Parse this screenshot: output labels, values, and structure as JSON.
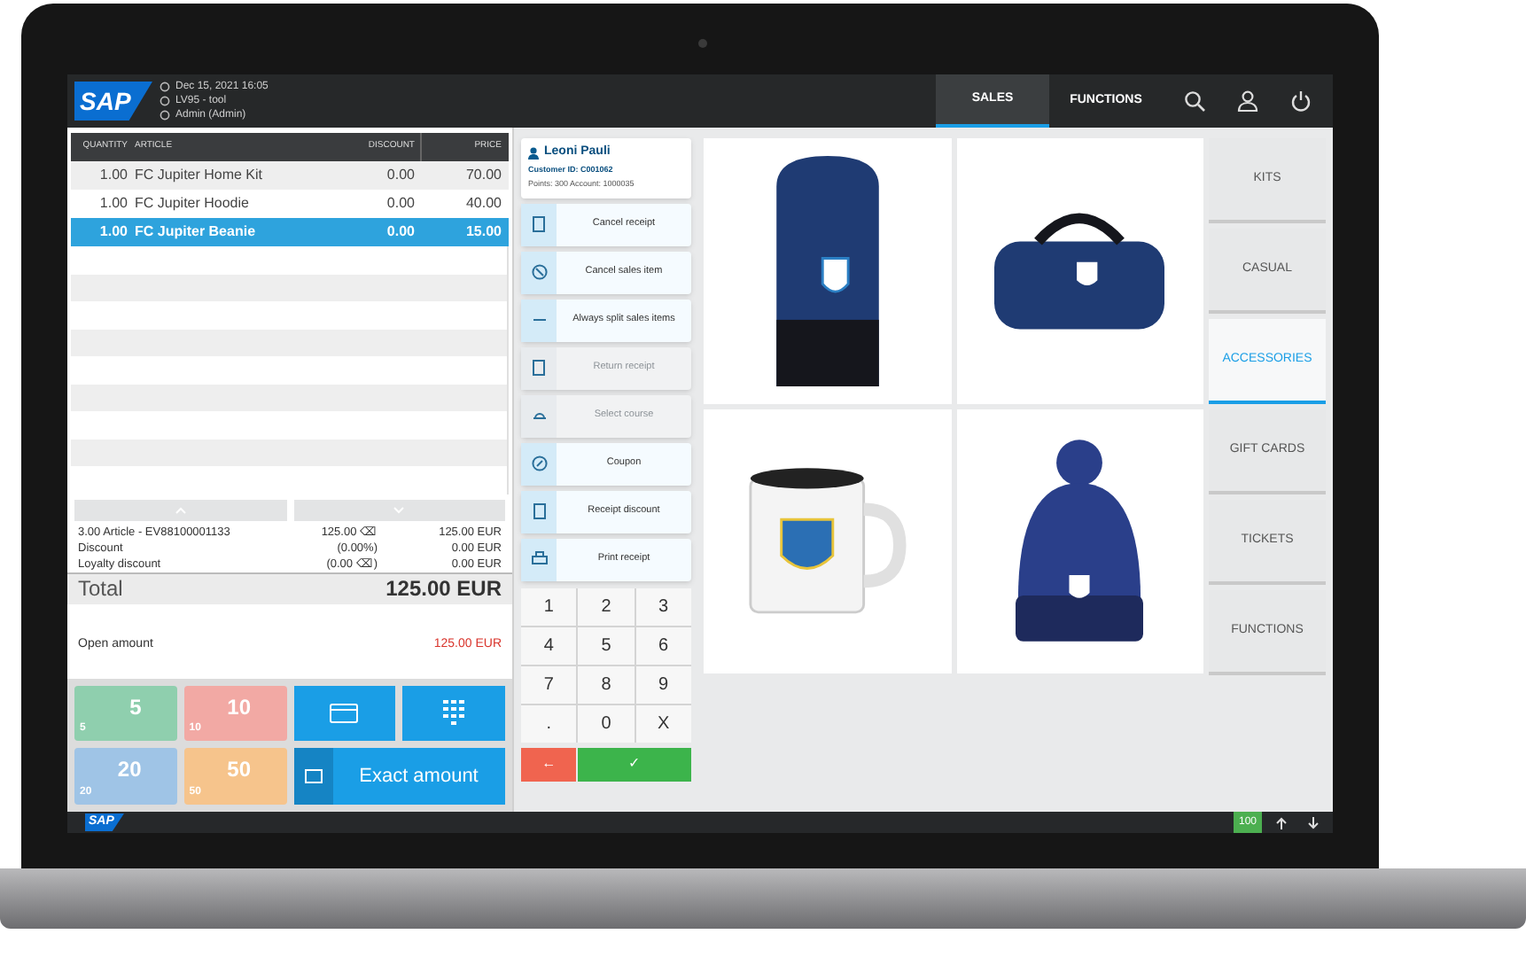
{
  "header": {
    "date": "Dec 15, 2021 16:05",
    "device": "LV95 - tool",
    "user": "Admin (Admin)"
  },
  "nav_tabs": [
    {
      "label": "SALES",
      "selected": true
    },
    {
      "label": "FUNCTIONS",
      "selected": false
    }
  ],
  "table": {
    "columns": [
      "QUANTITY",
      "ARTICLE",
      "DISCOUNT",
      "PRICE"
    ],
    "rows": [
      {
        "quantity": "1.00",
        "article": "FC Jupiter Home Kit",
        "discount": "0.00",
        "price": "70.00",
        "selected": false
      },
      {
        "quantity": "1.00",
        "article": "FC Jupiter Hoodie",
        "discount": "0.00",
        "price": "40.00",
        "selected": false
      },
      {
        "quantity": "1.00",
        "article": "FC Jupiter Beanie",
        "discount": "0.00",
        "price": "15.00",
        "selected": true
      }
    ]
  },
  "summary": [
    {
      "label": "3.00 Article - EV88100001133",
      "detail": "125.00 ⌫",
      "amount": "125.00 EUR"
    },
    {
      "label": "Discount",
      "detail": "(0.00%)",
      "amount": "0.00 EUR"
    },
    {
      "label": "Loyalty discount",
      "detail": "(0.00 ⌫)",
      "amount": "0.00 EUR"
    }
  ],
  "total": {
    "label": "Total",
    "amount": "125.00 EUR"
  },
  "open_amount": {
    "label": "Open amount",
    "amount": "125.00 EUR"
  },
  "banknotes": [
    {
      "value": "5",
      "corner": "5",
      "color": "#8fcfae"
    },
    {
      "value": "10",
      "corner": "10",
      "color": "#f2a9a4"
    },
    {
      "value": "20",
      "corner": "20",
      "color": "#9fc4e6"
    },
    {
      "value": "50",
      "corner": "50",
      "color": "#f6c48c"
    }
  ],
  "exact_amount": "Exact amount",
  "customer": {
    "name": "Leoni Pauli",
    "id": "Customer ID: C001062",
    "points": "Points: 300  Account: 1000035"
  },
  "actions": [
    {
      "label": "Cancel receipt",
      "disabled": false
    },
    {
      "label": "Cancel sales item",
      "disabled": false
    },
    {
      "label": "Always split sales items",
      "disabled": false
    },
    {
      "label": "Return receipt",
      "disabled": true
    },
    {
      "label": "Select course",
      "disabled": true
    },
    {
      "label": "Coupon",
      "disabled": false
    },
    {
      "label": "Receipt discount",
      "disabled": false
    },
    {
      "label": "Print receipt",
      "disabled": false
    }
  ],
  "keypad": [
    "1",
    "2",
    "3",
    "4",
    "5",
    "6",
    "7",
    "8",
    "9",
    ".",
    "0",
    "X"
  ],
  "keypad_actions": [
    {
      "kind": "back",
      "label": "←"
    },
    {
      "kind": "confirm",
      "label": "✓"
    }
  ],
  "products": [
    {
      "kind": "backpack"
    },
    {
      "kind": "duffel"
    },
    {
      "kind": "mug"
    },
    {
      "kind": "beanie"
    }
  ],
  "categories": [
    {
      "label": "KITS",
      "selected": false
    },
    {
      "label": "CASUAL",
      "selected": false
    },
    {
      "label": "ACCESSORIES",
      "selected": true
    },
    {
      "label": "GIFT CARDS",
      "selected": false
    },
    {
      "label": "TICKETS",
      "selected": false
    },
    {
      "label": "FUNCTIONS",
      "selected": false
    }
  ],
  "status_bar": {
    "logo": "SAP",
    "counter": "100"
  },
  "logo": "SAP"
}
